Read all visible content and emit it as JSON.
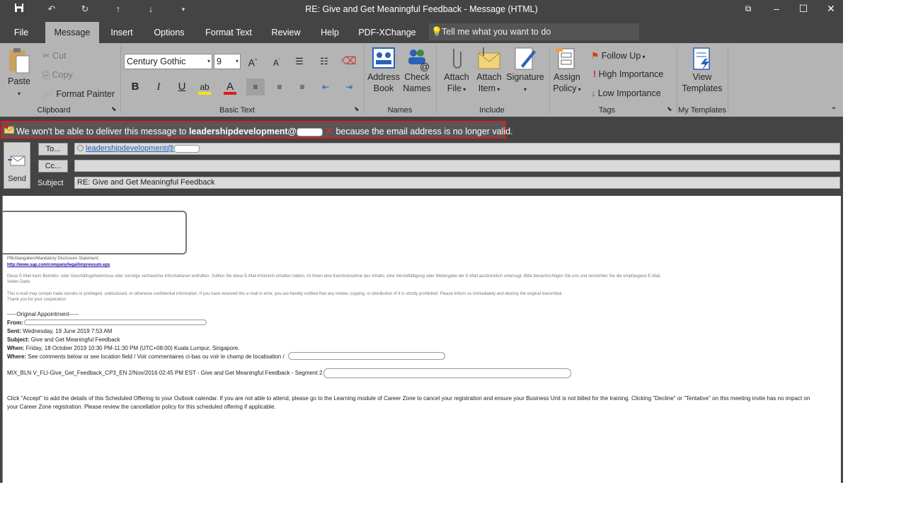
{
  "titlebar": {
    "title": "RE: Give and Get Meaningful Feedback  -  Message (HTML)",
    "quick_access": [
      "save-icon",
      "undo-icon",
      "redo-icon",
      "previous-item-icon",
      "next-item-icon",
      "customize-qat-icon"
    ],
    "window_controls": [
      "ribbon-display-icon",
      "minimize-icon",
      "maximize-icon",
      "close-icon"
    ]
  },
  "tabs": {
    "items": [
      "File",
      "Message",
      "Insert",
      "Options",
      "Format Text",
      "Review",
      "Help",
      "PDF-XChange"
    ],
    "active": "Message",
    "tell_me": "Tell me what you want to do"
  },
  "ribbon": {
    "clipboard": {
      "label": "Clipboard",
      "paste": "Paste",
      "cut": "Cut",
      "copy": "Copy",
      "format_painter": "Format Painter"
    },
    "basic_text": {
      "label": "Basic Text",
      "font": "Century Gothic",
      "size": "9",
      "bold": "B",
      "italic": "I",
      "underline": "U"
    },
    "names": {
      "label": "Names",
      "address_book_1": "Address",
      "address_book_2": "Book",
      "check_names_1": "Check",
      "check_names_2": "Names"
    },
    "include": {
      "label": "Include",
      "attach_file_1": "Attach",
      "attach_file_2": "File",
      "attach_item_1": "Attach",
      "attach_item_2": "Item",
      "signature": "Signature"
    },
    "tags": {
      "label": "Tags",
      "assign_policy_1": "Assign",
      "assign_policy_2": "Policy",
      "follow_up": "Follow Up",
      "high_importance": "High Importance",
      "low_importance": "Low Importance"
    },
    "my_templates": {
      "label": "My Templates",
      "view_templates_1": "View",
      "view_templates_2": "Templates"
    }
  },
  "infobar": {
    "text_before": "We won't be able to deliver this message to ",
    "address": "leadershipdevelopment@",
    "text_after": " because the email address is no longer valid."
  },
  "header": {
    "send": "Send",
    "to_button": "To...",
    "cc_button": "Cc...",
    "subject_label": "Subject",
    "to_value": "leadershipdevelopment@",
    "cc_value": "",
    "subject_value": "RE: Give and Get Meaningful Feedback"
  },
  "body": {
    "disclosure_title": "Pflichtangaben/Mandatory Disclosure Statement:",
    "disclosure_link": "http://www.sap.com/company/legal/impressum.epx",
    "german_notice": "Diese E-Mail kann Betriebs- oder Geschäftsgeheimnisse oder sonstige vertrauliche Informationen enthalten.  Sollten Sie diese E-Mail irrtümlich erhalten haben, ist Ihnen eine Kenntnisnahme des Inhalts, eine Vervielfältigung oder Weitergabe der E-Mail ausdrücklich untersagt. Bitte benachrichtigen Sie uns und vernichten Sie die empfangene E-Mail.",
    "german_thanks": "Vielen Dank.",
    "english_notice": "This e-mail may contain trade secrets or privileged, undisclosed, or otherwise confidential information.  If you have received this e-mail in error, you are hereby notified that any review, copying, or distribution of it is strictly prohibited. Please inform us immediately and destroy the original transmittal.",
    "english_thanks": "Thank you for your cooperation",
    "original_header": "-----Original Appointment-----",
    "from_label": "From:",
    "sent_label": "Sent:",
    "sent_value": "Wednesday, 19 June 2019 7:53 AM",
    "subject_label": "Subject:",
    "subject_value": "Give and Get Meaningful Feedback",
    "when_label": "When:",
    "when_value": "Friday, 18 October 2019 10:30 PM-11:30 PM (UTC+08:00) Kuala Lumpur, Singapore.",
    "where_label": "Where:",
    "where_value": "See comments below or see location field / Voir commentaires ci-bas ou voir le champ de localisation /",
    "course_line": "MIX_BLN V_FLI-Give_Get_Feedback_CP3_EN 2/Nov/2016 02:45 PM EST  -  Give and Get Meaningful Feedback  -  Segment 2  -",
    "instructions_1": "Click \"Accept\" to add the details of this Scheduled Offering to your Outlook calendar.  If you are not able to attend, please go to the Learning module of Career Zone to cancel your registration and ensure your Business Unit is not billed for the training.  Clicking \"Decline\" or \"Tentative\" on this meeting invite has no impact on",
    "instructions_2": "your  Career Zone registration. Please review the cancellation policy for this scheduled offering if applicable."
  },
  "colors": {
    "chrome": "#444444",
    "ribbon": "#b4b4b4",
    "alert_border": "#d81e1e",
    "link": "#1a0dab"
  }
}
